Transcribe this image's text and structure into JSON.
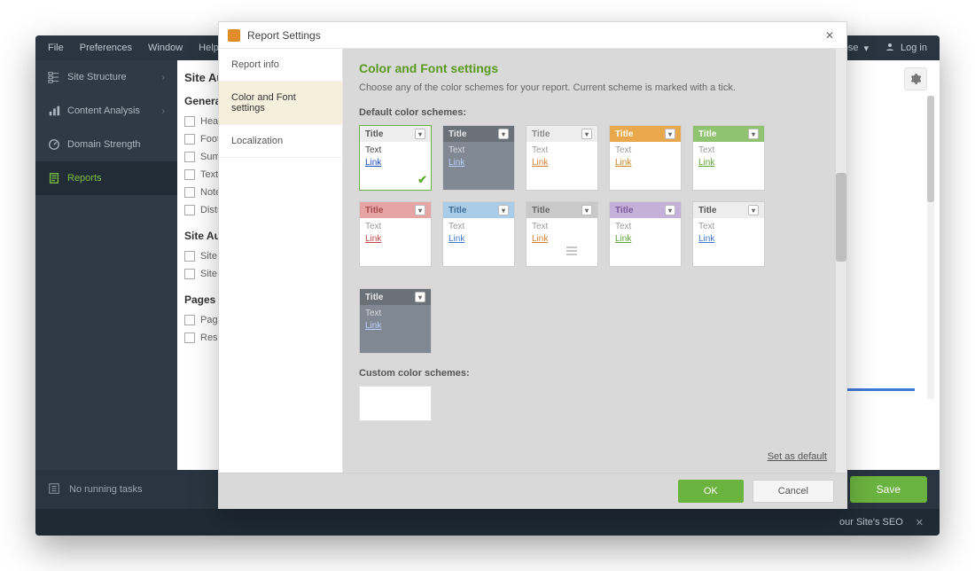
{
  "menubar": {
    "items": [
      "File",
      "Preferences",
      "Window",
      "Help"
    ],
    "close": "Close",
    "login": "Log in"
  },
  "leftnav": {
    "items": [
      {
        "label": "Site Structure",
        "chevron": true
      },
      {
        "label": "Content Analysis",
        "chevron": true
      },
      {
        "label": "Domain Strength",
        "chevron": false
      },
      {
        "label": "Reports",
        "chevron": false
      }
    ],
    "active_index": 3
  },
  "midpanel": {
    "title": "Site Au",
    "sections": [
      {
        "heading": "Genera",
        "items": [
          "Head",
          "Foote",
          "Summ",
          "Text",
          "Note",
          "Distri"
        ]
      },
      {
        "heading": "Site Au",
        "items": [
          "Site A",
          "Site A"
        ]
      },
      {
        "heading": "Pages &",
        "items": [
          "Pages",
          "Reso"
        ]
      }
    ]
  },
  "app_footer": {
    "status": "No running tasks",
    "save": "Save"
  },
  "banner": {
    "text": "our Site's SEO"
  },
  "dialog": {
    "title": "Report Settings",
    "tabs": [
      "Report info",
      "Color and Font settings",
      "Localization"
    ],
    "active_tab": 1,
    "heading": "Color and Font settings",
    "desc": "Choose any of the color schemes for your report. Current scheme is marked with a tick.",
    "section_default": "Default color schemes:",
    "section_custom": "Custom color schemes:",
    "schemes": [
      {
        "title_bg": "#ededed",
        "title_fg": "#555555",
        "body_bg": "#ffffff",
        "text": "#444444",
        "link": "#1a4ec4",
        "selected": true
      },
      {
        "title_bg": "#6a7179",
        "title_fg": "#e8e8e8",
        "body_bg": "#808893",
        "text": "#d7dade",
        "link": "#bcd1ff",
        "selected": false
      },
      {
        "title_bg": "#ededed",
        "title_fg": "#888888",
        "body_bg": "#ffffff",
        "text": "#9a9a9a",
        "link": "#d38134",
        "selected": false
      },
      {
        "title_bg": "#e9a84b",
        "title_fg": "#ffffff",
        "body_bg": "#ffffff",
        "text": "#9a9a9a",
        "link": "#c98621",
        "selected": false
      },
      {
        "title_bg": "#8fc36f",
        "title_fg": "#ffffff",
        "body_bg": "#ffffff",
        "text": "#9a9a9a",
        "link": "#5fa437",
        "selected": false
      },
      {
        "title_bg": "#e6a4a4",
        "title_fg": "#a54b4b",
        "body_bg": "#ffffff",
        "text": "#9a9a9a",
        "link": "#c04545",
        "selected": false
      },
      {
        "title_bg": "#a9cde9",
        "title_fg": "#3f6d95",
        "body_bg": "#ffffff",
        "text": "#9a9a9a",
        "link": "#3f79c6",
        "selected": false
      },
      {
        "title_bg": "#c9c9c9",
        "title_fg": "#666666",
        "body_bg": "#ffffff",
        "text": "#9a9a9a",
        "link": "#d38134",
        "selected": false
      },
      {
        "title_bg": "#c5b0d9",
        "title_fg": "#7a5a9a",
        "body_bg": "#ffffff",
        "text": "#9a9a9a",
        "link": "#5fa437",
        "selected": false
      },
      {
        "title_bg": "#ededed",
        "title_fg": "#555555",
        "body_bg": "#ffffff",
        "text": "#9a9a9a",
        "link": "#3f79c6",
        "selected": false
      },
      {
        "title_bg": "#6a7179",
        "title_fg": "#e8e8e8",
        "body_bg": "#808893",
        "text": "#d7dade",
        "link": "#bcd1ff",
        "selected": false
      }
    ],
    "swatch_labels": {
      "title": "Title",
      "text": "Text",
      "link": "Link"
    },
    "set_default": "Set as default",
    "ok": "OK",
    "cancel": "Cancel"
  }
}
